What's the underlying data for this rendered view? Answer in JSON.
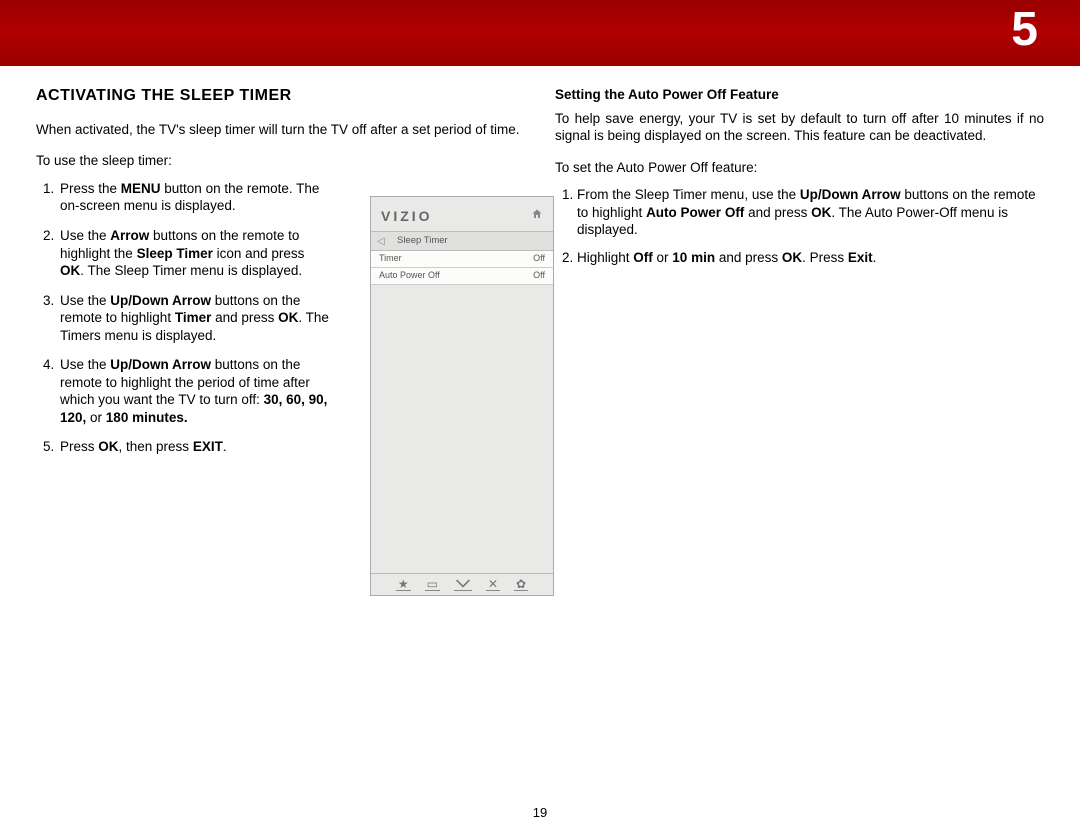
{
  "chapter": "5",
  "page_number": "19",
  "left": {
    "heading": "ACTIVATING THE SLEEP TIMER",
    "intro": "When activated, the TV's sleep timer will turn the TV off after a set period of time.",
    "lead": "To use the sleep timer:",
    "steps": [
      "Press the <b>MENU</b> button on the remote. The on-screen menu is displayed.",
      "Use the <b>Arrow</b> buttons on the remote to highlight the <b>Sleep Timer</b> icon and press <b>OK</b>. The Sleep Timer menu is displayed.",
      "Use the <b>Up/Down Arrow</b> buttons on the remote to highlight <b>Timer</b> and press <b>OK</b>. The Timers menu is displayed.",
      "Use the <b>Up/Down Arrow</b> buttons on the remote to highlight the period of time after which you want the TV to turn off: <b>30, 60, 90, 120,</b> or <b>180 minutes.</b>",
      "Press <b>OK</b>, then press <b>EXIT</b>."
    ]
  },
  "menu": {
    "brand": "VIZIO",
    "screen_title": "Sleep Timer",
    "rows": [
      {
        "label": "Timer",
        "value": "Off"
      },
      {
        "label": "Auto Power Off",
        "value": "Off"
      }
    ]
  },
  "right": {
    "sub_heading": "Setting the Auto Power Off Feature",
    "intro": "To help save energy, your TV is set by default to turn off after 10 minutes if no signal is being displayed on the screen. This feature can be deactivated.",
    "lead": "To set the Auto Power Off feature:",
    "steps": [
      "From the Sleep Timer menu, use the <b>Up/Down Arrow</b> buttons on the remote to highlight <b>Auto Power Off</b> and press <b>OK</b>. The Auto Power-Off menu is displayed.",
      "Highlight <b>Off</b> or <b>10 min</b> and press <b>OK</b>. Press <b>Exit</b>."
    ]
  }
}
